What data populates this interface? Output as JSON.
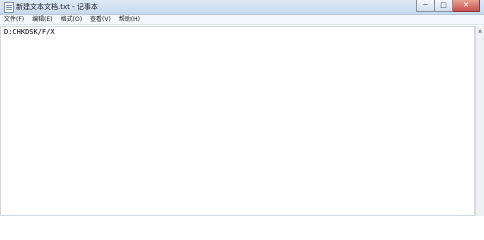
{
  "window": {
    "title": "新建文本文档.txt - 记事本",
    "buttons": {
      "minimize": "─",
      "maximize": "□",
      "close": "✕"
    }
  },
  "menu": [
    {
      "label": "文件(F)"
    },
    {
      "label": "编辑(E)"
    },
    {
      "label": "格式(O)"
    },
    {
      "label": "查看(V)"
    },
    {
      "label": "帮助(H)"
    }
  ],
  "editor": {
    "content": "D:CHKDSK/F/X"
  },
  "scrollbar": {
    "up_arrow": "▲"
  }
}
